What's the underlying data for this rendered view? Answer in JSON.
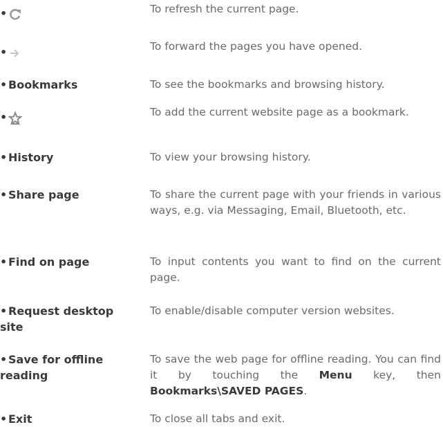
{
  "items": [
    {
      "icon": "refresh-icon",
      "term": "",
      "desc": "To refresh the current page."
    },
    {
      "icon": "forward-arrow-icon",
      "term": "",
      "desc": "To forward the pages you have opened."
    },
    {
      "term": "Bookmarks",
      "desc": "To see the bookmarks and browsing history."
    },
    {
      "icon": "star-bookmark-icon",
      "term": "",
      "desc": "To add the current website page as a bookmark."
    },
    {
      "term": "History",
      "desc": "To view your browsing history."
    },
    {
      "term": "Share page",
      "desc": "To share the current page with your friends in various ways, e.g. via Messaging, Email, Bluetooth, etc."
    },
    {
      "term": "Find on page",
      "desc": "To input contents you want to find on the current page."
    },
    {
      "term_line1": "Request desktop",
      "term_line2": "site",
      "desc": "To enable/disable computer version websites."
    },
    {
      "term_line1": "Save for offline",
      "term_line2": "reading",
      "desc_part1": "To save the web page for offline reading. You can find it by touching the ",
      "desc_bold1": "Menu",
      "desc_part2": " key, then ",
      "desc_bold2": "Bookmarks\\SAVED PAGES",
      "desc_part3": "."
    },
    {
      "term": "Exit",
      "desc": "To close all tabs and exit."
    }
  ],
  "bullet": "•"
}
